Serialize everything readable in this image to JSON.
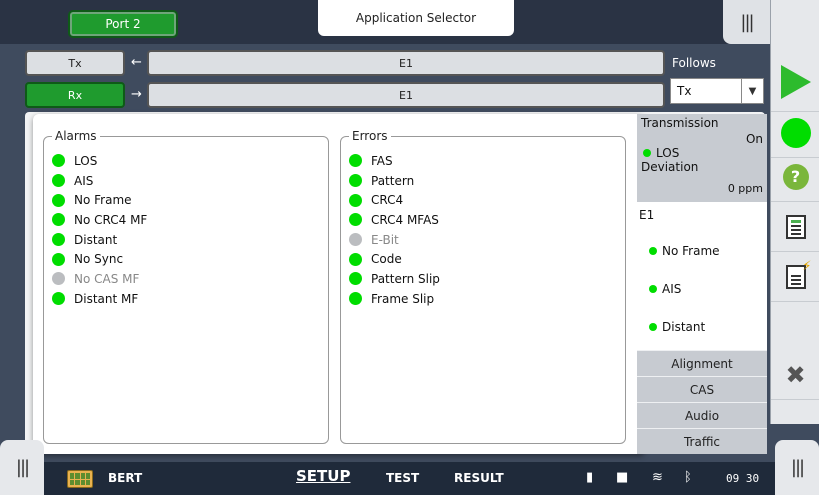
{
  "header": {
    "port_label": "Port 2",
    "app_selector_label": "Application Selector",
    "menu_icon": "hamburger-grip-icon"
  },
  "interface": {
    "tx_label": "Tx",
    "rx_label": "Rx",
    "tx_value": "E1",
    "rx_value": "E1",
    "follows_label": "Follows",
    "follows_value": "Tx"
  },
  "alarms_popup": {
    "alarms_title": "Alarms",
    "alarms": [
      {
        "label": "LOS",
        "active": true
      },
      {
        "label": "AIS",
        "active": true
      },
      {
        "label": "No Frame",
        "active": true
      },
      {
        "label": "No CRC4 MF",
        "active": true
      },
      {
        "label": "Distant",
        "active": true
      },
      {
        "label": "No Sync",
        "active": true
      },
      {
        "label": "No CAS MF",
        "active": false
      },
      {
        "label": "Distant MF",
        "active": true
      }
    ],
    "errors_title": "Errors",
    "errors": [
      {
        "label": "FAS",
        "active": true
      },
      {
        "label": "Pattern",
        "active": true
      },
      {
        "label": "CRC4",
        "active": true
      },
      {
        "label": "CRC4 MFAS",
        "active": true
      },
      {
        "label": "E-Bit",
        "active": false
      },
      {
        "label": "Code",
        "active": true
      },
      {
        "label": "Pattern Slip",
        "active": true
      },
      {
        "label": "Frame Slip",
        "active": true
      }
    ]
  },
  "status_panel": {
    "transmission_label": "Transmission",
    "transmission_value": "On",
    "los_label": "LOS",
    "deviation_label": "Deviation",
    "deviation_value": "0 ppm",
    "e1_title": "E1",
    "e1_items": [
      "No Frame",
      "AIS",
      "Distant"
    ],
    "tabs": [
      "Alignment",
      "CAS",
      "Audio",
      "Traffic"
    ]
  },
  "bottom_bar": {
    "app_name": "BERT",
    "tabs": [
      "SETUP",
      "TEST",
      "RESULT"
    ],
    "time": "09 30"
  },
  "colors": {
    "accent_green": "#1f9b2e",
    "led_on": "#00dd00",
    "led_off": "#bbbdc0",
    "background": "#3f4b5e"
  }
}
